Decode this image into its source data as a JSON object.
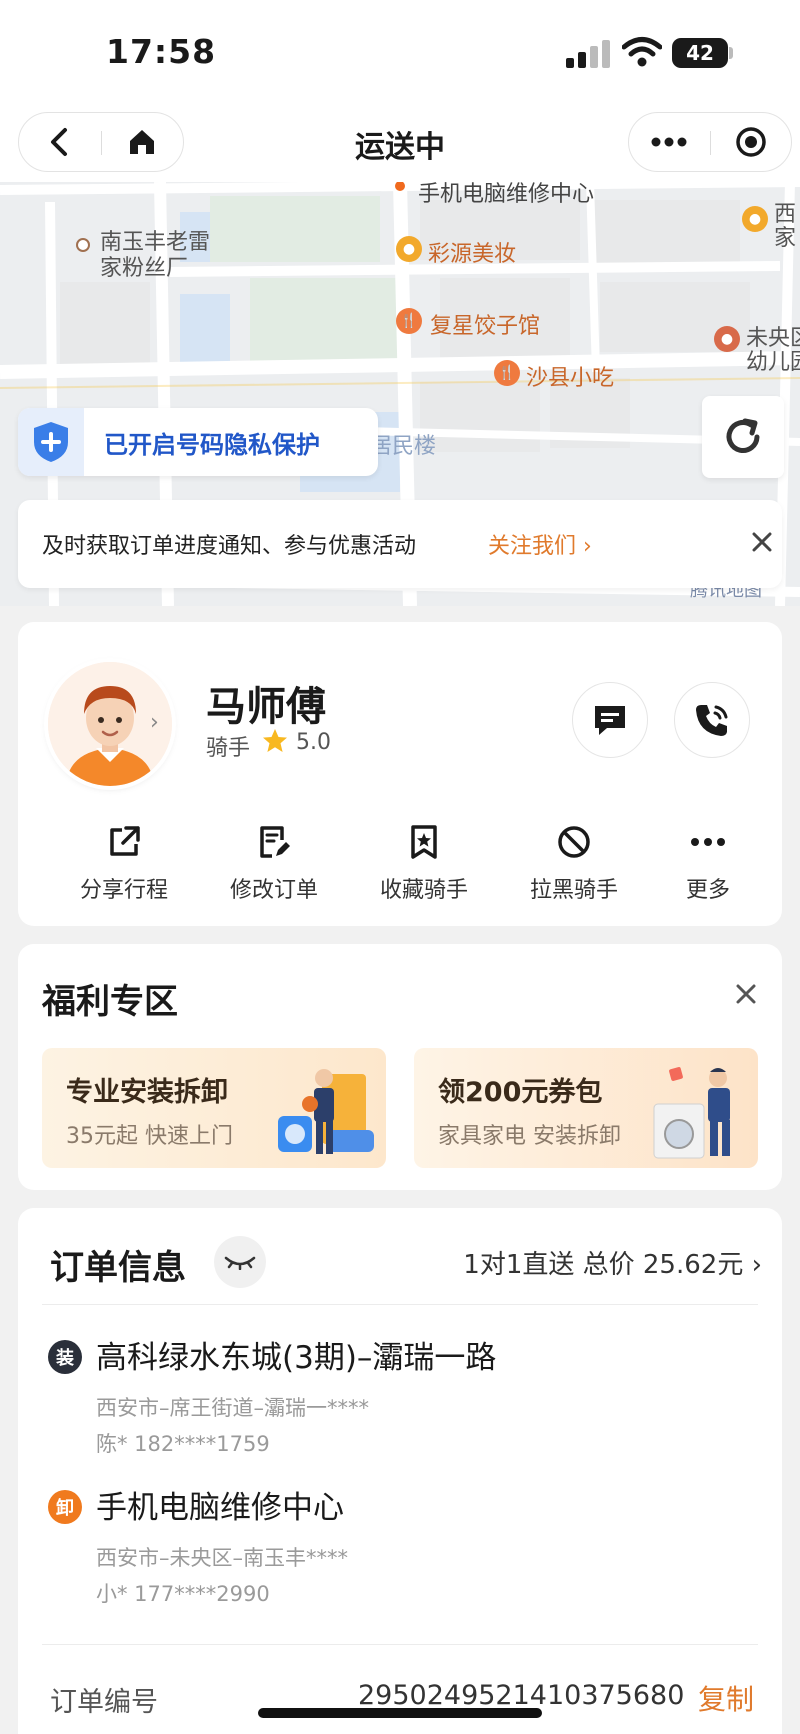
{
  "status_bar": {
    "time": "17:58",
    "battery": "42"
  },
  "nav": {
    "title": "运送中"
  },
  "map": {
    "labels": [
      "手机电脑维修中心",
      "南玉丰老雷",
      "家粉丝厂",
      "彩源美妆",
      "复星饺子馆",
      "沙县小吃",
      "未央区",
      "幼儿园",
      "西",
      "家",
      "居民楼",
      "腾讯地图"
    ],
    "privacy_text": "已开启号码隐私保护",
    "notice_text": "及时获取订单进度通知、参与优惠活动",
    "notice_link": "关注我们 ›"
  },
  "rider": {
    "name": "马师傅",
    "role": "骑手",
    "score": "5.0",
    "actions": [
      {
        "label": "分享行程",
        "icon": "share-icon"
      },
      {
        "label": "修改订单",
        "icon": "edit-order-icon"
      },
      {
        "label": "收藏骑手",
        "icon": "bookmark-star-icon"
      },
      {
        "label": "拉黑骑手",
        "icon": "block-icon"
      },
      {
        "label": "更多",
        "icon": "more-icon"
      }
    ]
  },
  "welfare": {
    "title": "福利专区",
    "promos": [
      {
        "title": "专业安装拆卸",
        "subtitle": "35元起 快速上门"
      },
      {
        "title": "领200元券包",
        "subtitle": "家具家电 安装拆卸"
      }
    ]
  },
  "order": {
    "title": "订单信息",
    "summary": "1对1直送 总价 25.62元 ›",
    "pickup": {
      "badge": "装",
      "name": "高科绿水东城(3期)–灞瑞一路",
      "address": "西安市–席王街道–灞瑞一****",
      "contact": "陈* 182****1759"
    },
    "dropoff": {
      "badge": "卸",
      "name": "手机电脑维修中心",
      "address": "西安市–未央区–南玉丰****",
      "contact": "小* 177****2990"
    },
    "number_label": "订单编号",
    "number_value": "2950249521410375680",
    "copy_label": "复制"
  },
  "colors": {
    "accent": "#e07a2c",
    "privacy_blue": "#2157c8",
    "pickup_badge": "#2a2f3a",
    "dropoff_badge": "#f07a1e"
  }
}
